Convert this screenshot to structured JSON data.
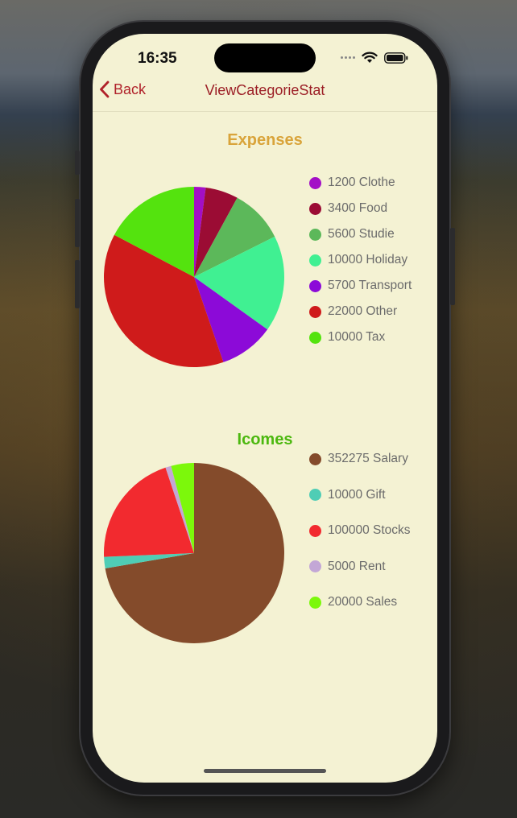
{
  "status_bar": {
    "time": "16:35"
  },
  "nav": {
    "back_label": "Back",
    "title": "ViewCategorieStat",
    "accent_color": "#b0222a"
  },
  "expenses": {
    "title": "Expenses",
    "title_color": "#d9a43a"
  },
  "incomes": {
    "title": "Icomes",
    "title_color": "#4cb80f"
  },
  "chart_data": [
    {
      "type": "pie",
      "title": "Expenses",
      "categories": [
        "Clothe",
        "Food",
        "Studie",
        "Holiday",
        "Transport",
        "Other",
        "Tax"
      ],
      "values": [
        1200,
        3400,
        5600,
        10000,
        5700,
        22000,
        10000
      ],
      "labels": [
        "1200 Clothe",
        "3400 Food",
        "5600 Studie",
        "10000 Holiday",
        "5700 Transport",
        "22000 Other",
        "10000 Tax"
      ],
      "colors": [
        "#a30fc6",
        "#9b0c34",
        "#5cb85a",
        "#40f092",
        "#8c0ad8",
        "#cf1b1b",
        "#54e30e"
      ],
      "legend": "right"
    },
    {
      "type": "pie",
      "title": "Icomes",
      "categories": [
        "Salary",
        "Gift",
        "Stocks",
        "Rent",
        "Sales"
      ],
      "values": [
        352275,
        10000,
        100000,
        5000,
        20000
      ],
      "labels": [
        "352275 Salary",
        "10000 Gift",
        "100000 Stocks",
        "5000 Rent",
        "20000 Sales"
      ],
      "colors": [
        "#844b2b",
        "#4fcdb5",
        "#f22a2f",
        "#c3a7d6",
        "#7cf80b"
      ],
      "legend": "right"
    }
  ]
}
